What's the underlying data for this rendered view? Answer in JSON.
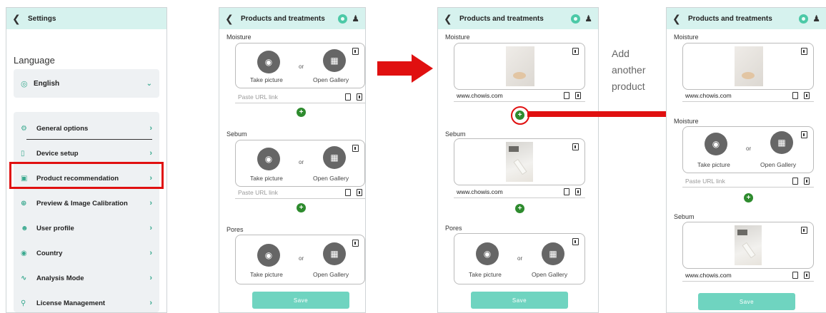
{
  "settings": {
    "title": "Settings",
    "language_heading": "Language",
    "language_value": "English",
    "menu": [
      {
        "label": "General options",
        "icon": "gear-icon"
      },
      {
        "label": "Device setup",
        "icon": "device-icon"
      },
      {
        "label": "Product recommendation",
        "icon": "product-icon"
      },
      {
        "label": "Preview & Image Calibration",
        "icon": "calibration-icon"
      },
      {
        "label": "User profile",
        "icon": "user-icon"
      },
      {
        "label": "Country",
        "icon": "globe-icon"
      },
      {
        "label": "Analysis Mode",
        "icon": "analysis-icon"
      },
      {
        "label": "License Management",
        "icon": "key-icon"
      }
    ]
  },
  "products": {
    "title": "Products and treatments",
    "sections": {
      "moisture": "Moisture",
      "sebum": "Sebum",
      "pores": "Pores"
    },
    "take_picture": "Take picture",
    "or": "or",
    "open_gallery": "Open Gallery",
    "url_placeholder": "Paste URL link",
    "url_value": "www.chowis.com",
    "save": "Save"
  },
  "annotation": {
    "line1": "Add",
    "line2": "another",
    "line3": "product"
  },
  "colors": {
    "accent": "#6fd4c0",
    "header_bg": "#d6f2ee",
    "highlight_red": "#e01010",
    "add_green": "#2e8b2e"
  }
}
